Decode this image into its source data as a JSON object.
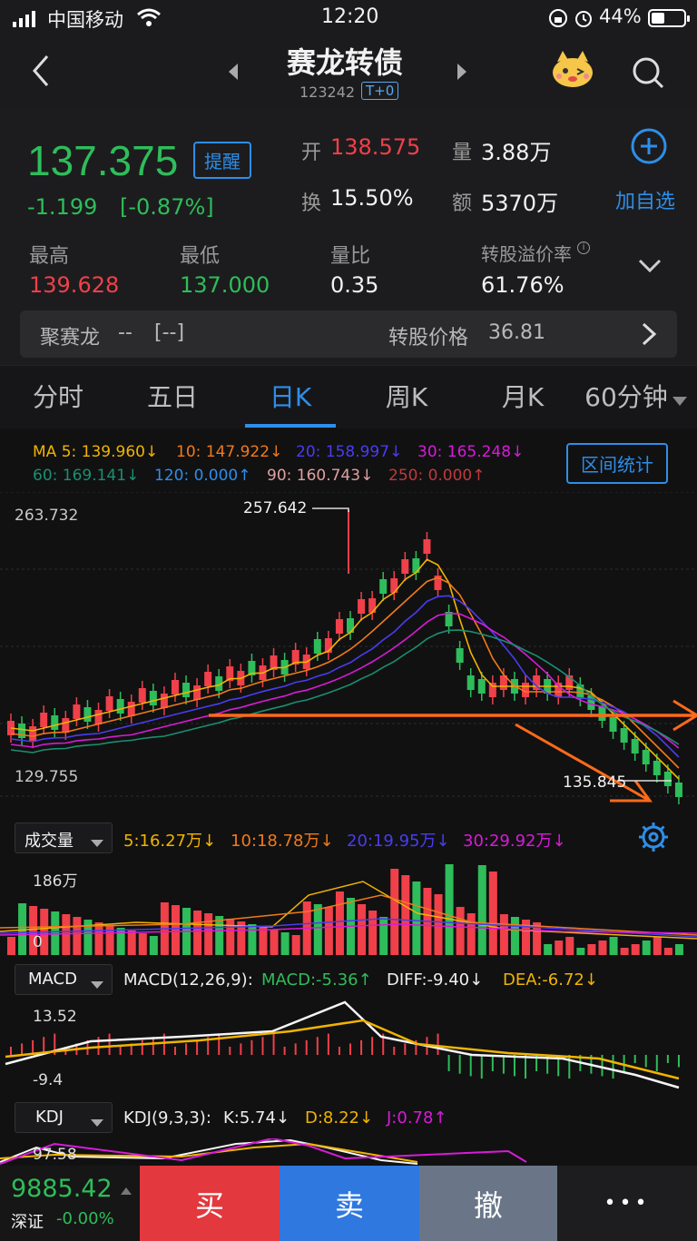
{
  "status": {
    "carrier": "中国移动",
    "time": "12:20",
    "battery": "44%"
  },
  "header": {
    "title": "赛龙转债",
    "code": "123242",
    "badge": "T+0"
  },
  "quote": {
    "price": "137.375",
    "alert_label": "提醒",
    "change": "-1.199",
    "change_pct": "[-0.87%]",
    "open_label": "开",
    "open": "138.575",
    "volume_label": "量",
    "volume": "3.88万",
    "turnover_label": "换",
    "turnover": "15.50%",
    "amount_label": "额",
    "amount": "5370万",
    "add_watch": "加自选",
    "high_label": "最高",
    "high": "139.628",
    "low_label": "最低",
    "low": "137.000",
    "vol_ratio_label": "量比",
    "vol_ratio": "0.35",
    "premium_label": "转股溢价率",
    "premium": "61.76%",
    "stock_name": "聚赛龙",
    "stock_value": "--",
    "stock_pct": "[--]",
    "conv_price_label": "转股价格",
    "conv_price": "36.81"
  },
  "tabs": [
    "分时",
    "五日",
    "日K",
    "周K",
    "月K",
    "60分钟"
  ],
  "active_tab": 2,
  "ma": {
    "ma5": "MA 5: 139.960↓",
    "ma10": "10: 147.922↓",
    "ma20": "20: 158.997↓",
    "ma30": "30: 165.248↓",
    "ma60": "60: 169.141↓",
    "ma120": "120: 0.000↑",
    "ma90": "90: 160.743↓",
    "ma250": "250: 0.000↑",
    "interval_btn": "区间统计"
  },
  "kline": {
    "top_label": "263.732",
    "bottom_label": "129.755",
    "peak_label": "257.642",
    "low_label": "135.845"
  },
  "volume": {
    "selector": "成交量",
    "v5": "5:16.27万↓",
    "v10": "10:18.78万↓",
    "v20": "20:19.95万↓",
    "v30": "30:29.92万↓",
    "max_label": "186万",
    "zero_label": "0"
  },
  "macd": {
    "selector": "MACD",
    "params": "MACD(12,26,9):",
    "macd": "MACD:-5.36↑",
    "diff": "DIFF:-9.40↓",
    "dea": "DEA:-6.72↓",
    "top": "13.52",
    "bottom": "-9.4"
  },
  "kdj": {
    "selector": "KDJ",
    "params": "KDJ(9,3,3):",
    "k": "K:5.74↓",
    "d": "D:8.22↓",
    "j": "J:0.78↑",
    "top": "97.58"
  },
  "bottom": {
    "index_value": "9885.42",
    "index_name": "深证",
    "index_change": "-0.00%",
    "buy": "买",
    "sell": "卖",
    "cancel": "撤",
    "more": "•••"
  },
  "colors": {
    "up": "#f0404a",
    "down": "#2ebd5a",
    "accent": "#2e8ee8",
    "ma5": "#f0b400",
    "ma10": "#f07a1a",
    "ma20": "#4a3cf0",
    "ma30": "#d81bd8",
    "ma60": "#1a8f70"
  }
}
